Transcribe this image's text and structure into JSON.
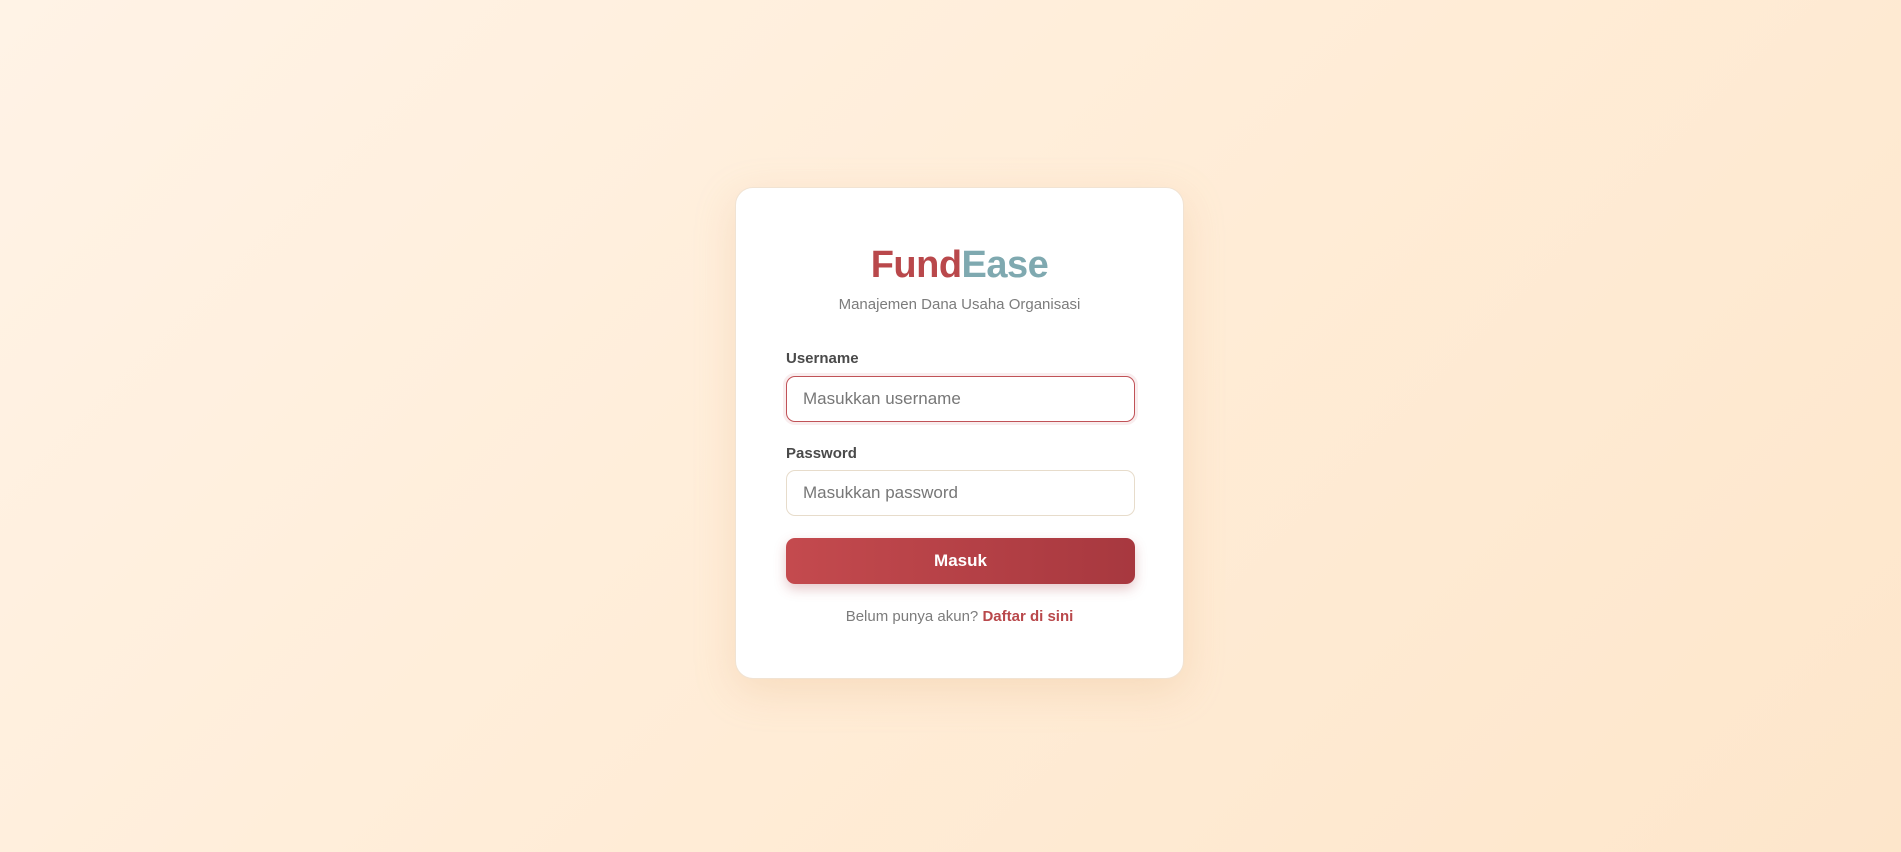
{
  "brand": {
    "part1": "Fund",
    "part2": "Ease",
    "subtitle": "Manajemen Dana Usaha Organisasi",
    "color_primary": "#b9484b",
    "color_secondary": "#7fa9b0"
  },
  "form": {
    "username": {
      "label": "Username",
      "placeholder": "Masukkan username",
      "value": ""
    },
    "password": {
      "label": "Password",
      "placeholder": "Masukkan password",
      "value": ""
    },
    "submit_label": "Masuk"
  },
  "footer": {
    "prompt": "Belum punya akun?",
    "register_link": "Daftar di sini"
  }
}
